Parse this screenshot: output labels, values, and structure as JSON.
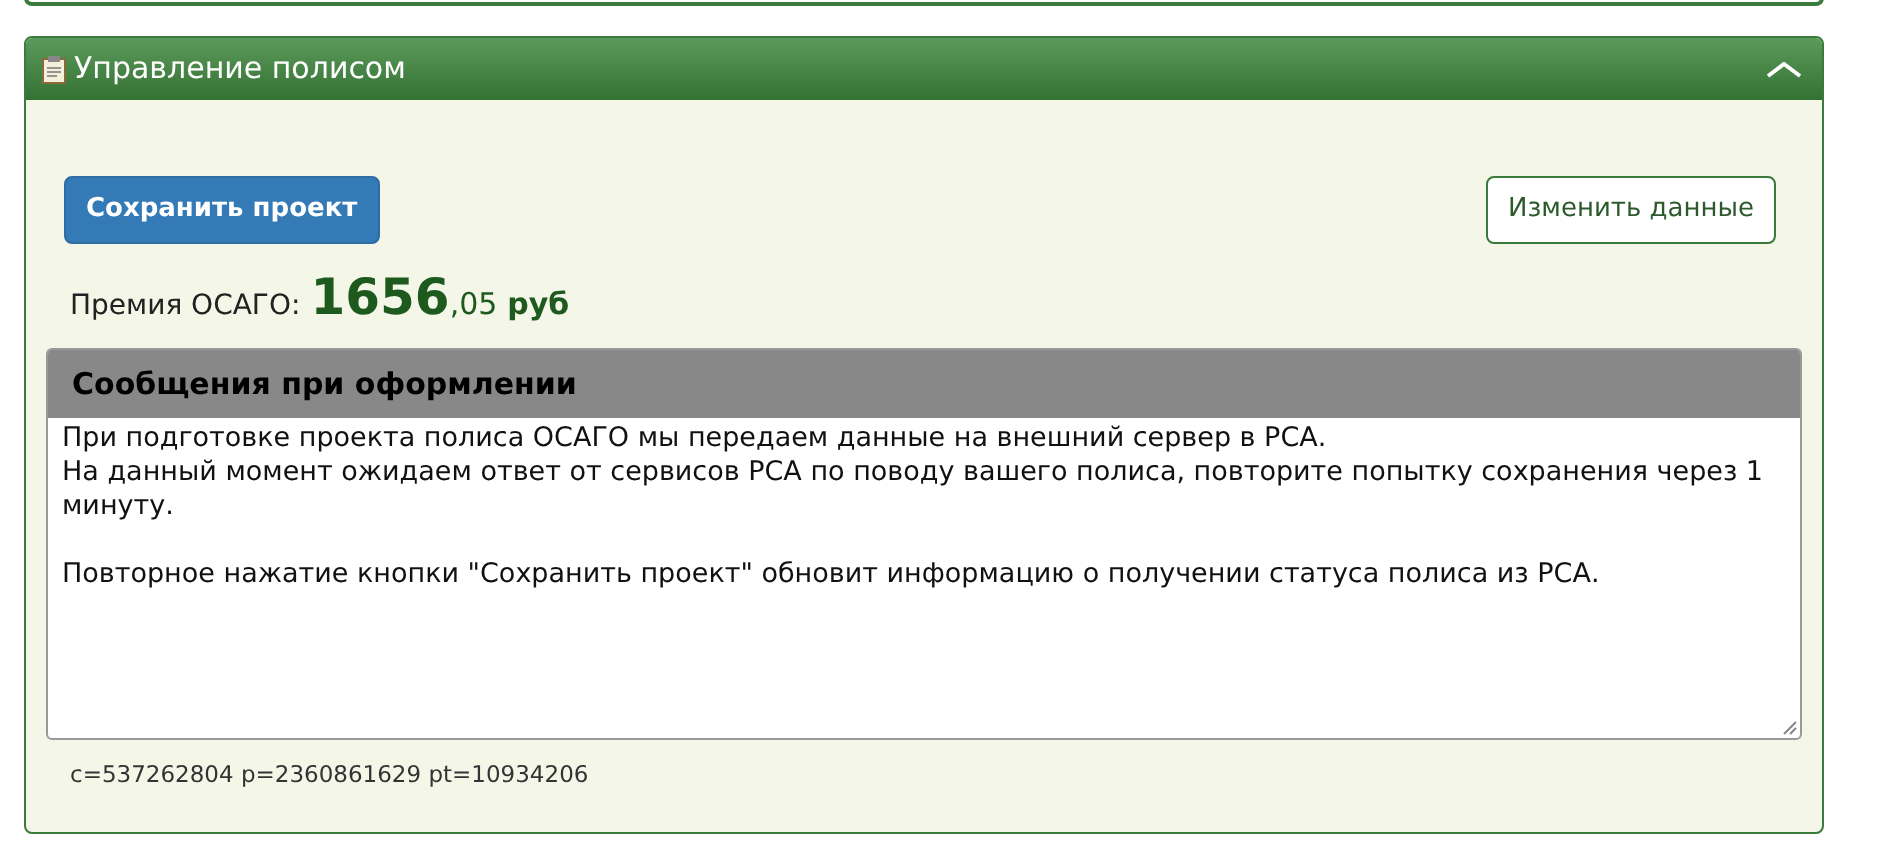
{
  "panel": {
    "title": "Управление полисом",
    "expanded": true
  },
  "buttons": [
    {
      "label": "Сохранить проект",
      "kind": "primary"
    },
    {
      "label": "Изменить данные",
      "kind": "outline"
    }
  ],
  "premium": {
    "label": "Премия ОСАГО:",
    "integer": "1656",
    "fraction": ",05",
    "currency": "руб"
  },
  "messages": {
    "title": "Сообщения при оформлении",
    "paragraphs": [
      "При подготовке проекта полиса ОСАГО мы передаем данные на внешний сервер в РСА.\nНа данный момент ожидаем ответ от сервисов РСА по поводу вашего полиса, повторите попытку сохранения через 1 минуту.",
      "Повторное нажатие кнопки \"Сохранить проект\" обновит информацию о получении статуса полиса из РСА."
    ]
  },
  "debug": "c=537262804 p=2360861629 pt=10934206"
}
